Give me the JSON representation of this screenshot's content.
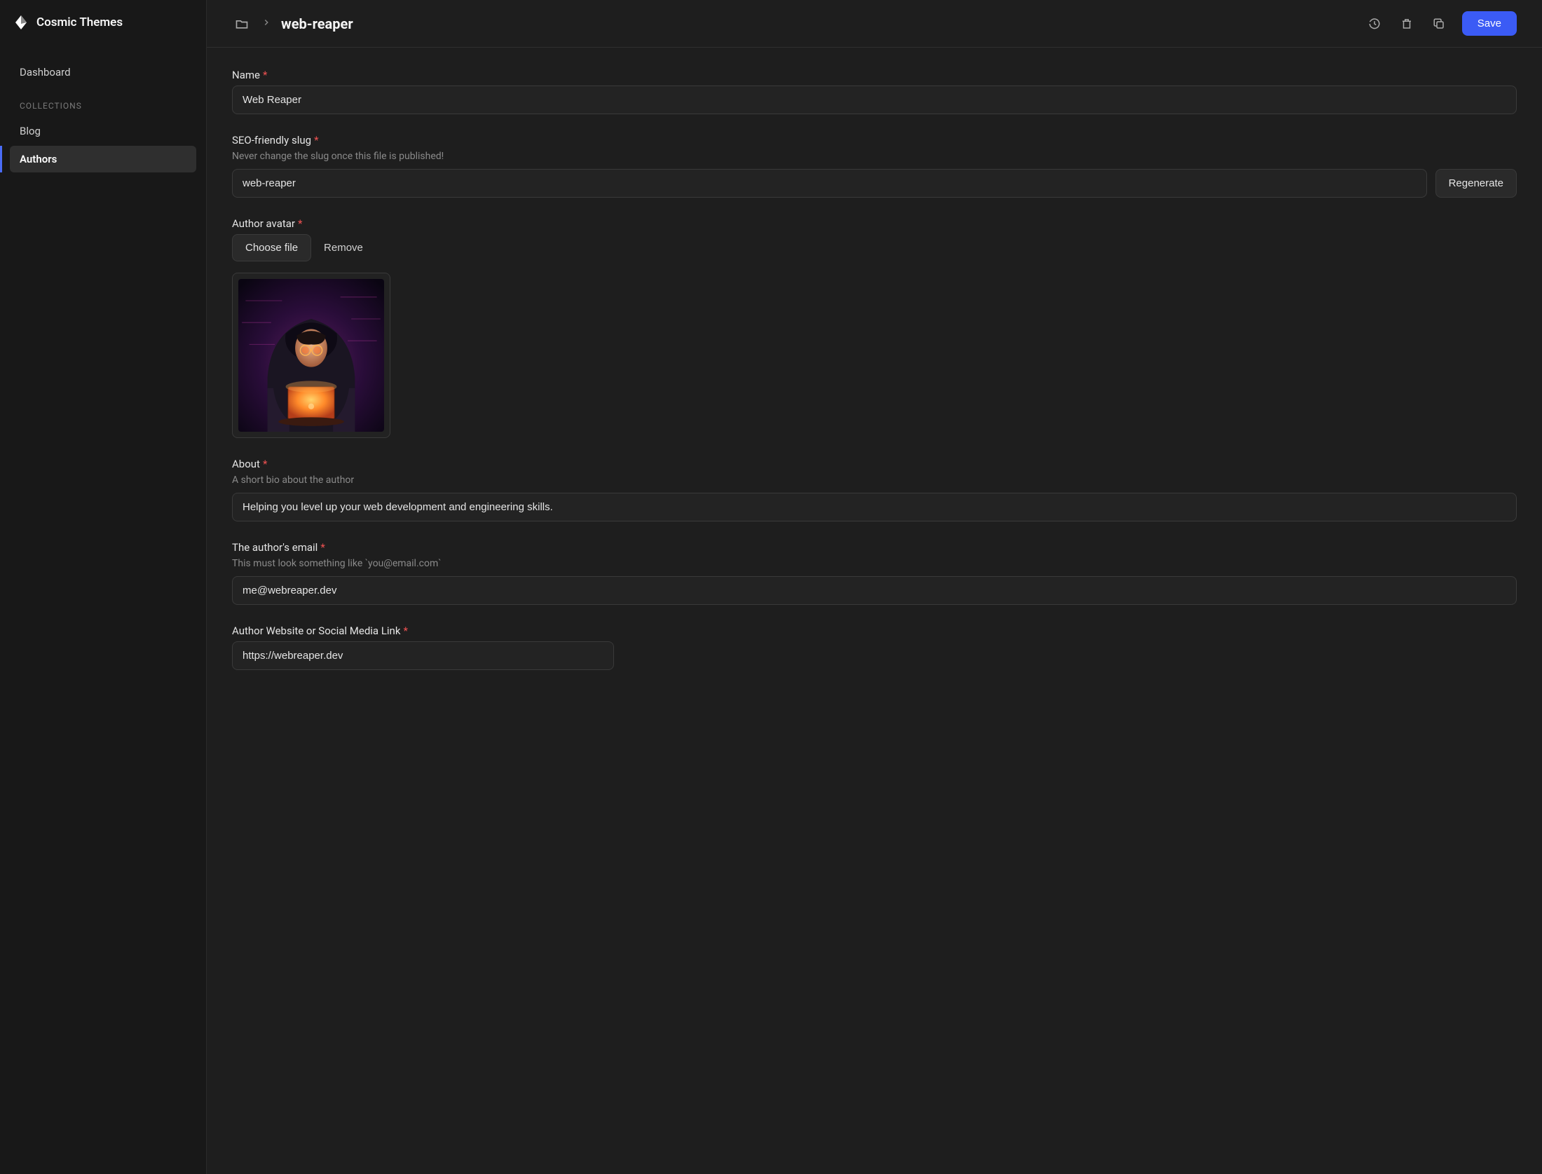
{
  "brand": {
    "name": "Cosmic Themes"
  },
  "sidebar": {
    "dashboard": "Dashboard",
    "collections_label": "COLLECTIONS",
    "items": [
      {
        "label": "Blog",
        "active": false
      },
      {
        "label": "Authors",
        "active": true
      }
    ]
  },
  "topbar": {
    "file_name": "web-reaper",
    "save": "Save"
  },
  "fields": {
    "name": {
      "label": "Name",
      "value": "Web Reaper"
    },
    "slug": {
      "label": "SEO-friendly slug",
      "hint": "Never change the slug once this file is published!",
      "value": "web-reaper",
      "regenerate": "Regenerate"
    },
    "avatar": {
      "label": "Author avatar",
      "choose": "Choose file",
      "remove": "Remove"
    },
    "about": {
      "label": "About",
      "hint": "A short bio about the author",
      "value": "Helping you level up your web development and engineering skills."
    },
    "email": {
      "label": "The author's email",
      "hint": "This must look something like `you@email.com`",
      "value": "me@webreaper.dev"
    },
    "link": {
      "label": "Author Website or Social Media Link",
      "value": "https://webreaper.dev"
    }
  }
}
